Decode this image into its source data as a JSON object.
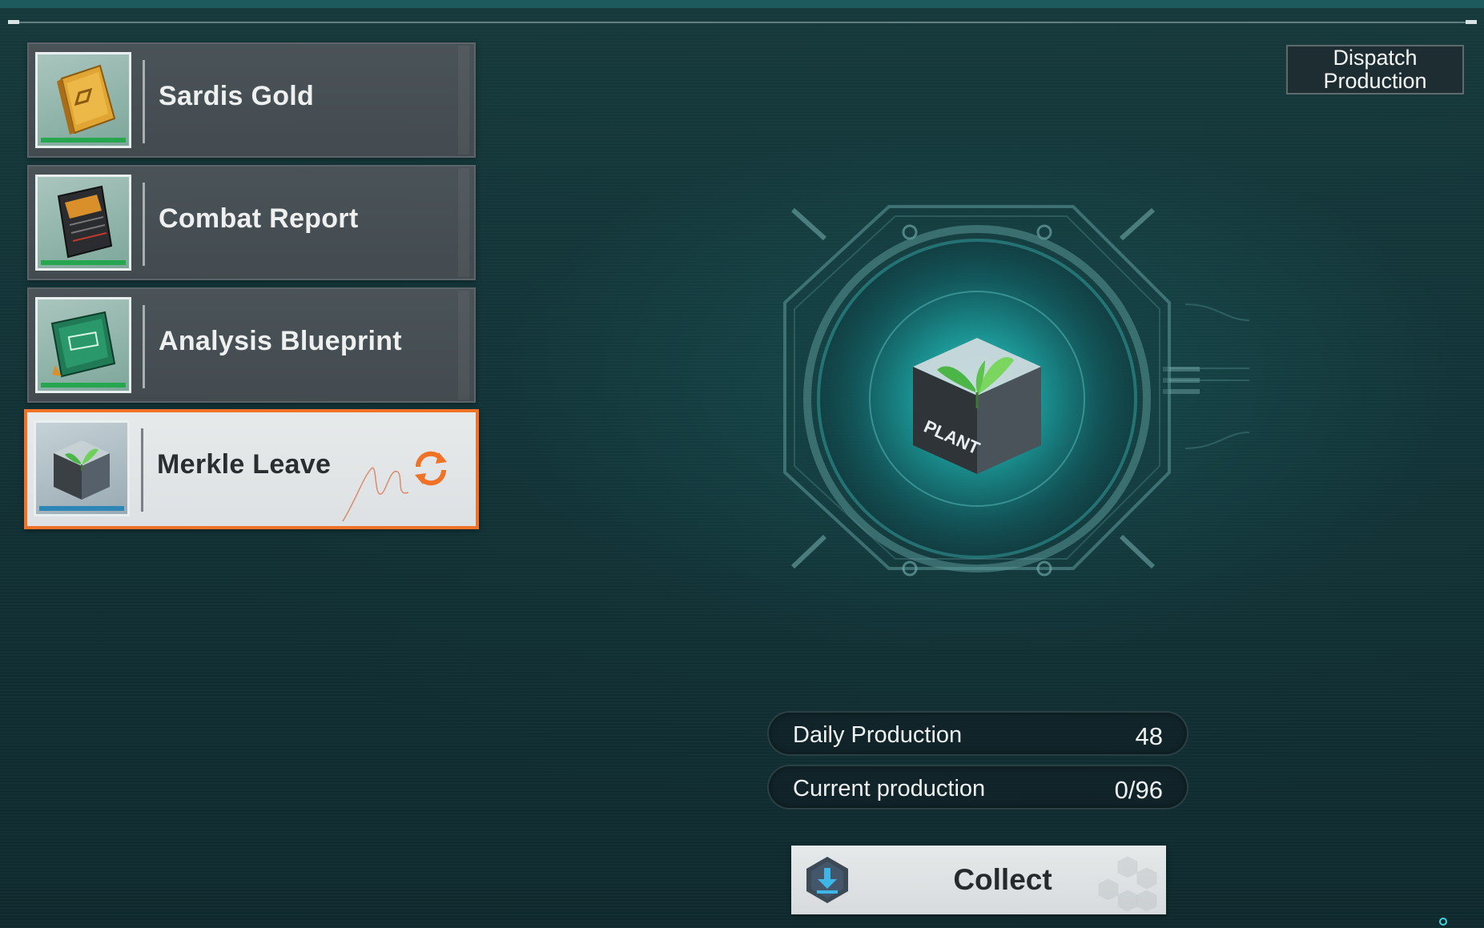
{
  "items": [
    {
      "name": "Sardis Gold",
      "icon": "gold-bar-icon",
      "status_color": "#27a650",
      "selected": false
    },
    {
      "name": "Combat Report",
      "icon": "combat-report-icon",
      "status_color": "#27a650",
      "selected": false
    },
    {
      "name": "Analysis Blueprint",
      "icon": "blueprint-icon",
      "status_color": "#27a650",
      "selected": false
    },
    {
      "name": "Merkle Leave",
      "icon": "plant-cube-icon",
      "status_color": "#2d86b6",
      "selected": true
    }
  ],
  "dispatch": {
    "label": "Dispatch\nProduction"
  },
  "emblem": {
    "icon": "plant-cube-icon",
    "cube_label": "PLANT"
  },
  "stats": {
    "daily_label": "Daily Production",
    "daily_value": "48",
    "current_label": "Current production",
    "current_value": "0/96"
  },
  "collect": {
    "label": "Collect",
    "icon": "download-hex-icon"
  },
  "colors": {
    "accent_selected": "#f07227",
    "teal_glow": "#2fb8b8",
    "background": "#133236"
  }
}
